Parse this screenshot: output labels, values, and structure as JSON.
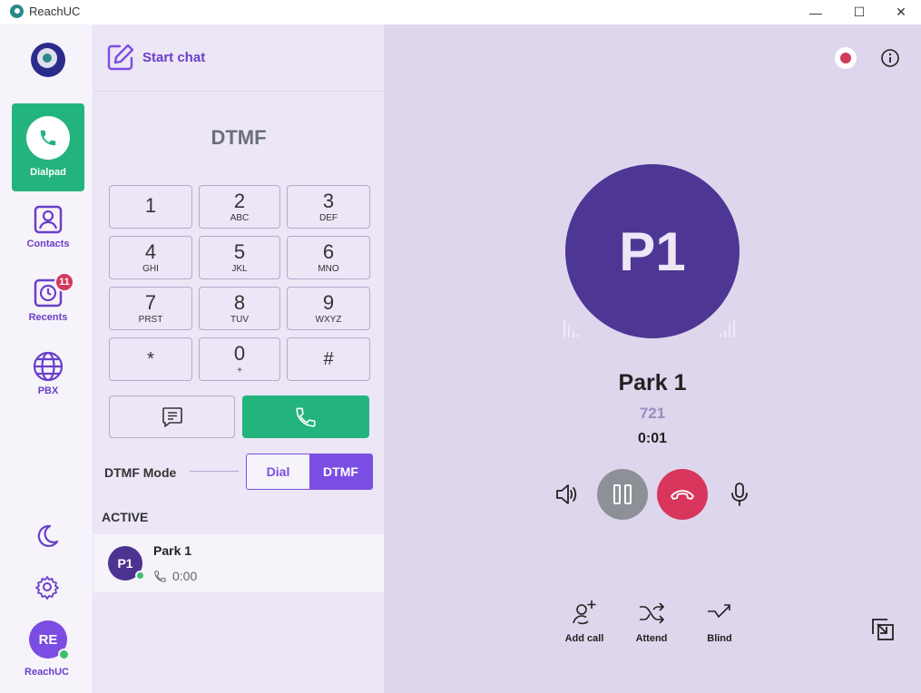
{
  "window": {
    "title": "ReachUC",
    "minimize": "—",
    "maximize": "☐",
    "close": "✕"
  },
  "nav": {
    "dialpad": "Dialpad",
    "contacts": "Contacts",
    "recents": "Recents",
    "recents_badge": "11",
    "pbx": "PBX",
    "user_initials": "RE",
    "user_label": "ReachUC"
  },
  "dialer": {
    "start_chat": "Start chat",
    "title": "DTMF",
    "keys": [
      {
        "digit": "1",
        "letters": ""
      },
      {
        "digit": "2",
        "letters": "ABC"
      },
      {
        "digit": "3",
        "letters": "DEF"
      },
      {
        "digit": "4",
        "letters": "GHI"
      },
      {
        "digit": "5",
        "letters": "JKL"
      },
      {
        "digit": "6",
        "letters": "MNO"
      },
      {
        "digit": "7",
        "letters": "PRST"
      },
      {
        "digit": "8",
        "letters": "TUV"
      },
      {
        "digit": "9",
        "letters": "WXYZ"
      },
      {
        "digit": "*",
        "letters": ""
      },
      {
        "digit": "0",
        "letters": "+"
      },
      {
        "digit": "#",
        "letters": ""
      }
    ],
    "mode_label": "DTMF Mode",
    "mode_options": [
      "Dial",
      "DTMF"
    ],
    "mode_selected": "DTMF"
  },
  "active": {
    "heading": "ACTIVE",
    "call": {
      "initials": "P1",
      "name": "Park 1",
      "duration": "0:00"
    }
  },
  "call": {
    "initials": "P1",
    "name": "Park 1",
    "number": "721",
    "duration": "0:01",
    "actions": {
      "add_call": "Add call",
      "attend": "Attend",
      "blind": "Blind"
    }
  },
  "colors": {
    "accent": "#7b4de2",
    "green": "#23b47e",
    "hangup": "#d8365c",
    "avatar": "#4e3694"
  }
}
